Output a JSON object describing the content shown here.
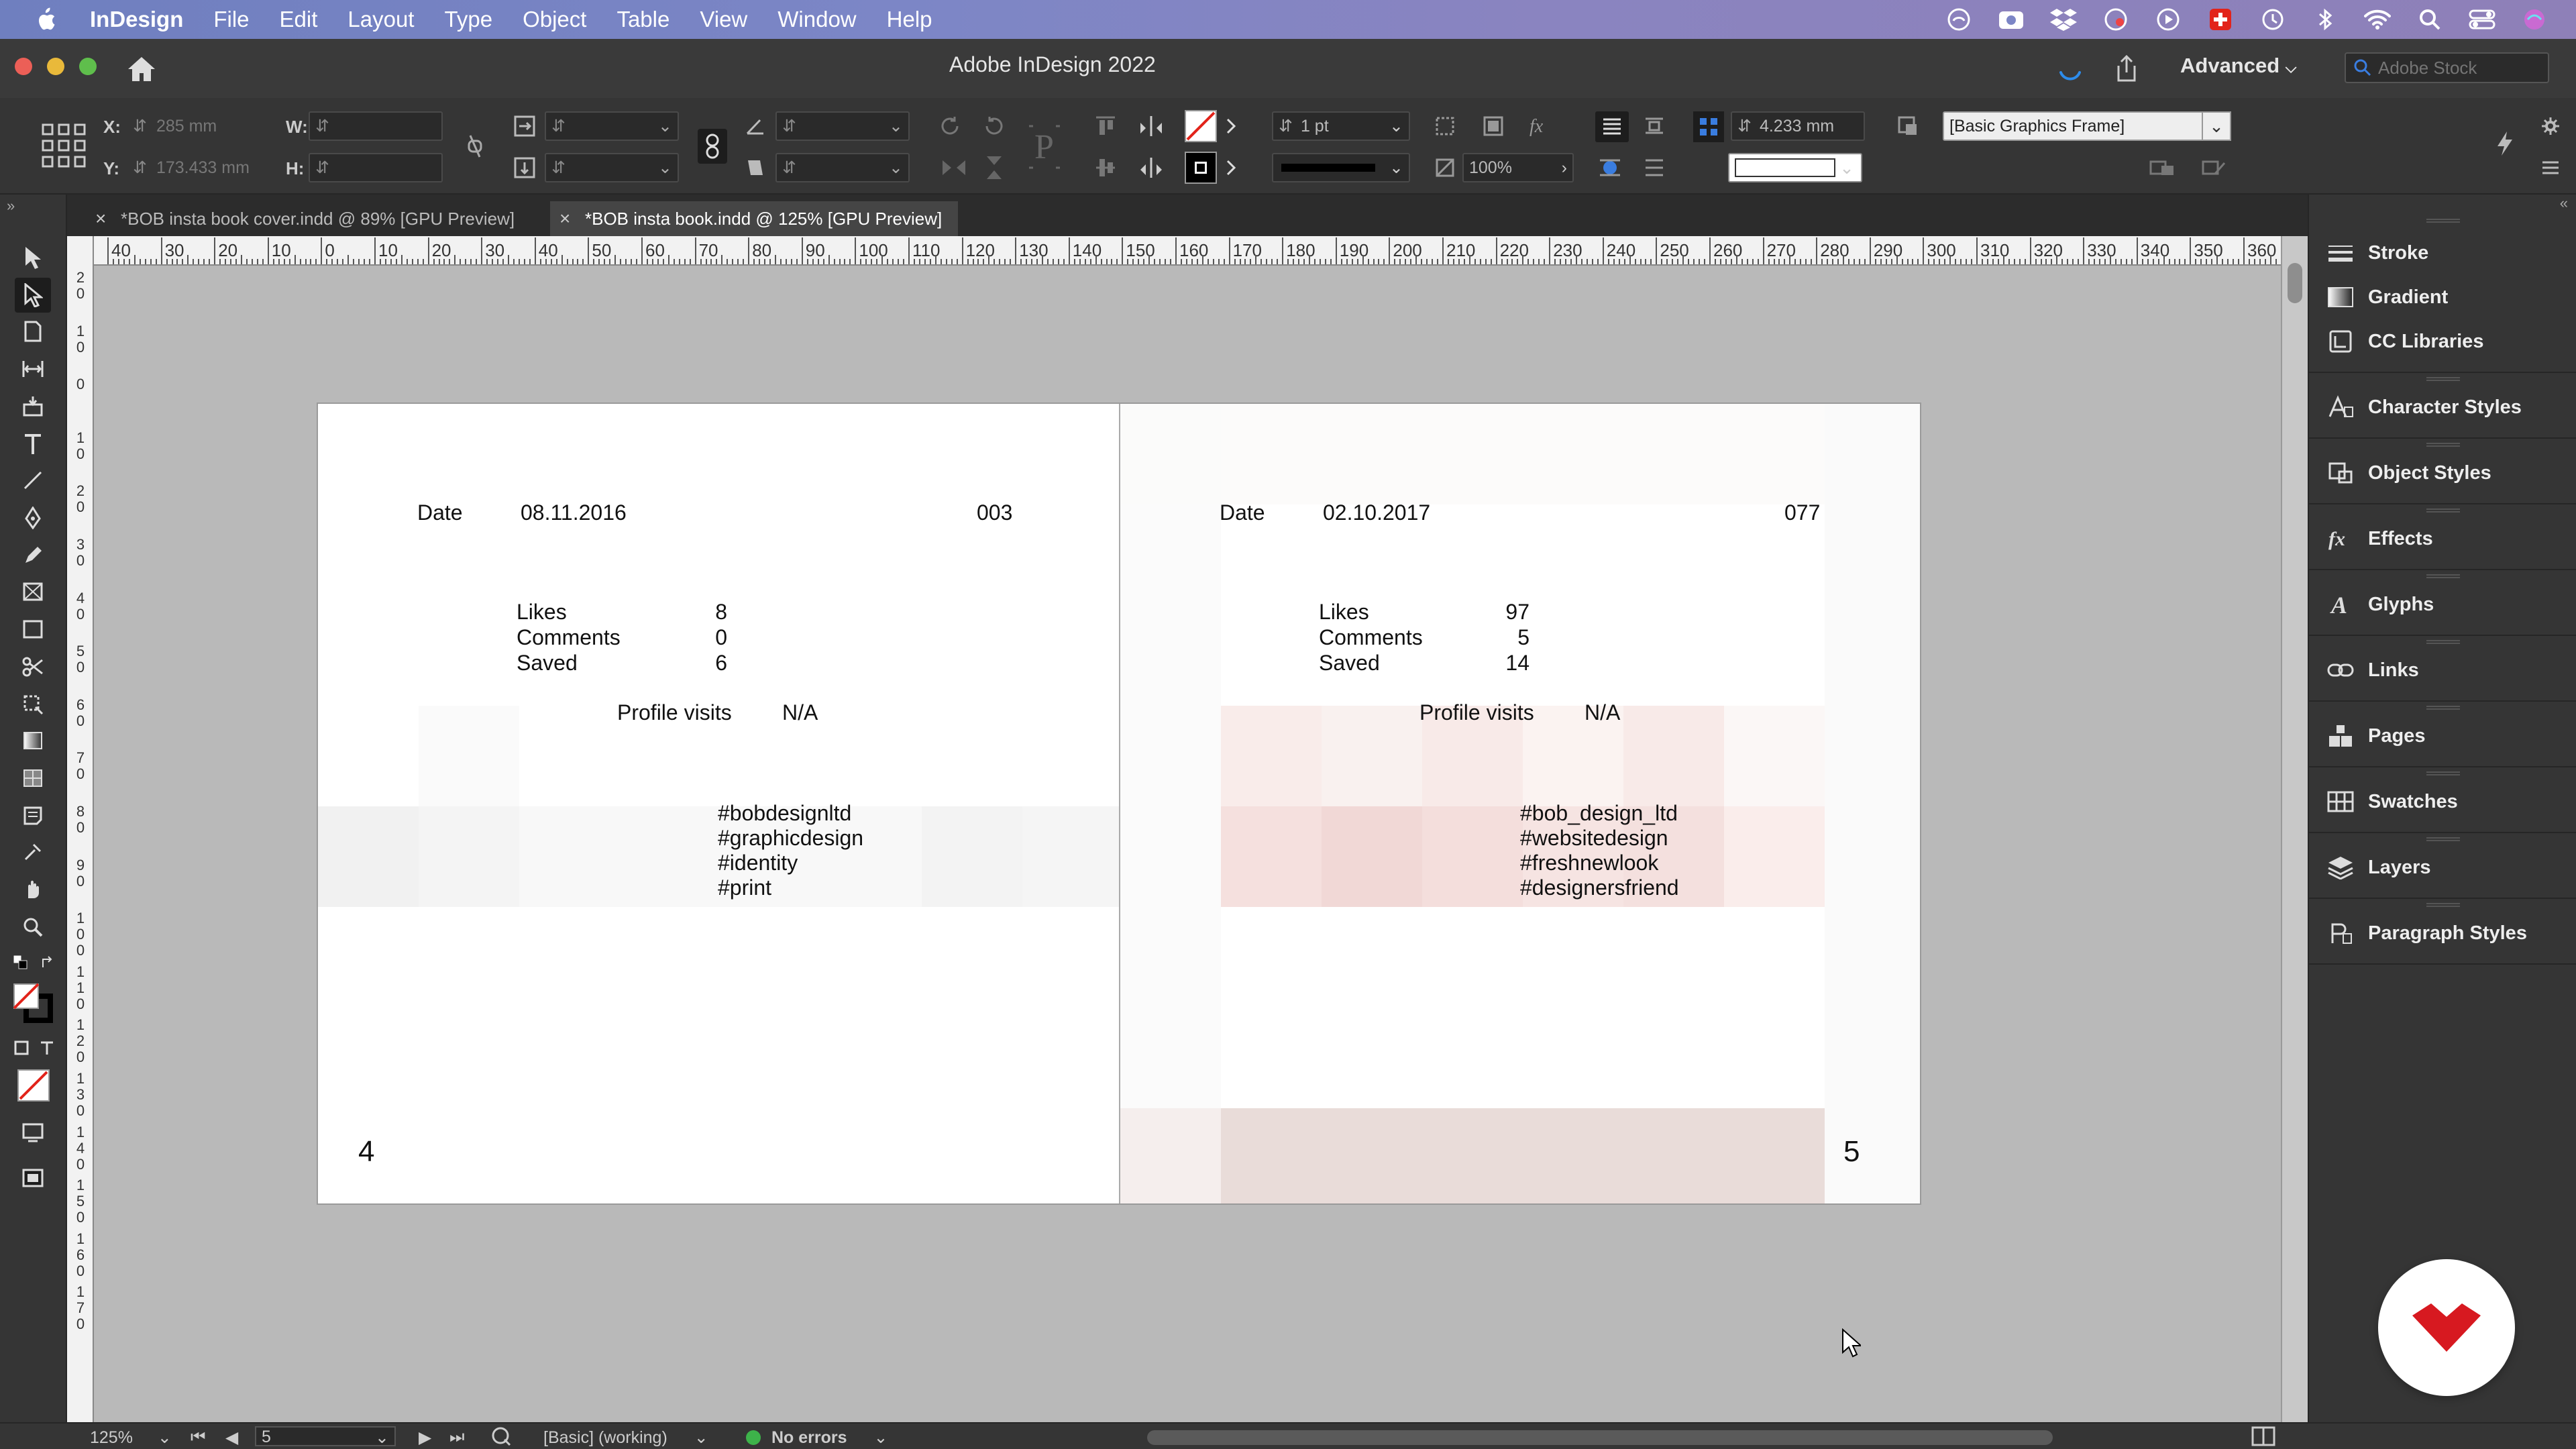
{
  "menubar": {
    "items": [
      "InDesign",
      "File",
      "Edit",
      "Layout",
      "Type",
      "Object",
      "Table",
      "View",
      "Window",
      "Help"
    ]
  },
  "titlebar": {
    "title": "Adobe InDesign 2022",
    "workspace": "Advanced",
    "stock_placeholder": "Adobe Stock"
  },
  "control": {
    "x_label": "X:",
    "y_label": "Y:",
    "w_label": "W:",
    "h_label": "H:",
    "x_value": "285 mm",
    "y_value": "173.433 mm",
    "stroke_weight": "1 pt",
    "opacity": "100%",
    "frame_offset": "4.233 mm",
    "object_style": "[Basic Graphics Frame]"
  },
  "tabs": [
    {
      "label": "*BOB insta book cover.indd @ 89% [GPU Preview]"
    },
    {
      "label": "*BOB insta book.indd @ 125% [GPU Preview]"
    }
  ],
  "ruler": {
    "top": [
      "40",
      "30",
      "20",
      "10",
      "0",
      "10",
      "20",
      "30",
      "40",
      "50",
      "60",
      "70",
      "80",
      "90",
      "100",
      "110",
      "120",
      "130",
      "140",
      "150",
      "160",
      "170",
      "180",
      "190",
      "200",
      "210",
      "220",
      "230",
      "240",
      "250",
      "260",
      "270",
      "280",
      "290",
      "300",
      "310",
      "320",
      "330",
      "340",
      "350",
      "360"
    ],
    "left": [
      "2\n0",
      "1\n0",
      "0",
      "1\n0",
      "2\n0",
      "3\n0",
      "4\n0",
      "5\n0",
      "6\n0",
      "7\n0",
      "8\n0",
      "9\n0",
      "1\n0\n0",
      "1\n1\n0",
      "1\n2\n0",
      "1\n3\n0",
      "1\n4\n0",
      "1\n5\n0",
      "1\n6\n0",
      "1\n7\n0"
    ]
  },
  "spread": {
    "left": {
      "date_label": "Date",
      "date": "08.11.2016",
      "post_no": "003",
      "likes_label": "Likes",
      "likes": "8",
      "comments_label": "Comments",
      "comments": "0",
      "saved_label": "Saved",
      "saved": "6",
      "visits_label": "Profile visits",
      "visits": "N/A",
      "hashtags": [
        "#bobdesignltd",
        "#graphicdesign",
        "#identity",
        "#print"
      ],
      "page_number": "4"
    },
    "right": {
      "date_label": "Date",
      "date": "02.10.2017",
      "post_no": "077",
      "likes_label": "Likes",
      "likes": "97",
      "comments_label": "Comments",
      "comments": "5",
      "saved_label": "Saved",
      "saved": "14",
      "visits_label": "Profile visits",
      "visits": "N/A",
      "hashtags": [
        "#bob_design_ltd",
        "#websitedesign",
        "#freshnewlook",
        "#designersfriend"
      ],
      "page_number": "5"
    }
  },
  "panels": [
    "Stroke",
    "Gradient",
    "CC Libraries",
    "Character Styles",
    "Object Styles",
    "Effects",
    "Glyphs",
    "Links",
    "Pages",
    "Swatches",
    "Layers",
    "Paragraph Styles"
  ],
  "statusbar": {
    "zoom": "125%",
    "page": "5",
    "profile": "[Basic] (working)",
    "preflight": "No errors"
  },
  "colors": {
    "menubar": "#7c86c6",
    "chrome": "#353535",
    "pasteboard": "#b9b9b9",
    "ok_green": "#3db34a",
    "brand_red": "#d71920"
  }
}
